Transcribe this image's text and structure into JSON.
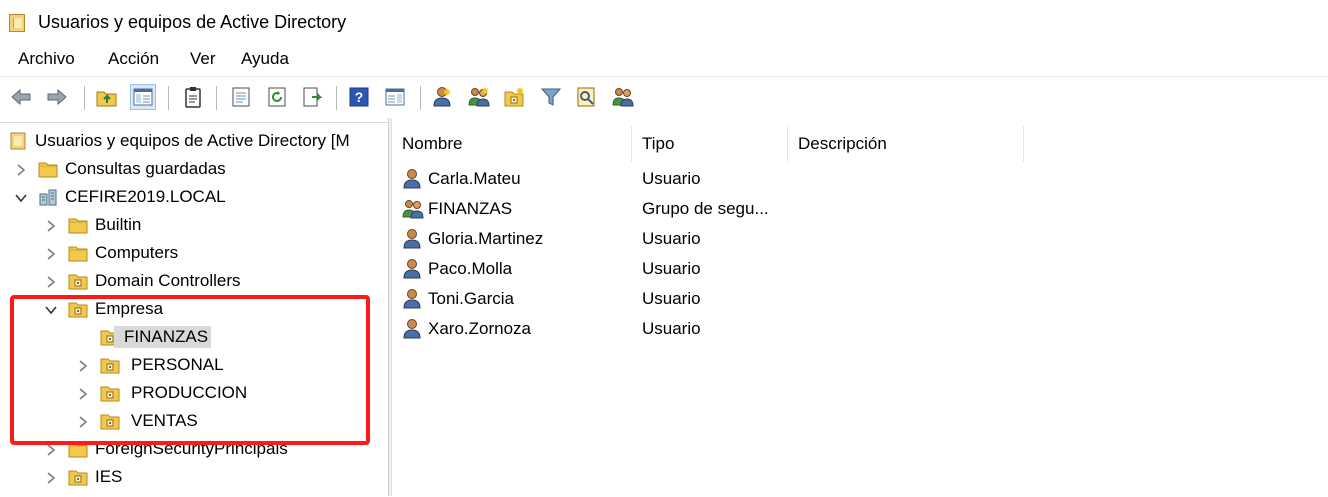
{
  "window": {
    "title": "Usuarios y equipos de Active Directory"
  },
  "menu": [
    "Archivo",
    "Acción",
    "Ver",
    "Ayuda"
  ],
  "toolbar": [
    "back-arrow-icon",
    "forward-arrow-icon",
    "up-folder-icon",
    "show-hide-tree-icon",
    "clipboard-icon",
    "properties-icon",
    "refresh-icon",
    "export-list-icon",
    "help-icon",
    "console-tree-icon",
    "new-user-icon",
    "new-group-icon",
    "new-ou-icon",
    "filter-icon",
    "find-icon",
    "add-to-group-icon"
  ],
  "tree": {
    "root": "Usuarios y equipos de Active Directory [M",
    "saved_queries": "Consultas guardadas",
    "domain": "CEFIRE2019.LOCAL",
    "children": [
      "Builtin",
      "Computers",
      "Domain Controllers"
    ],
    "empresa": "Empresa",
    "empresa_children": [
      "FINANZAS",
      "PERSONAL",
      "PRODUCCION",
      "VENTAS"
    ],
    "after": [
      "ForeignSecurityPrincipals",
      "IES"
    ]
  },
  "list": {
    "columns": {
      "name": "Nombre",
      "type": "Tipo",
      "description": "Descripción"
    },
    "rows": [
      {
        "name": "Carla.Mateu",
        "type": "Usuario",
        "icon": "user-icon"
      },
      {
        "name": "FINANZAS",
        "type": "Grupo de segu...",
        "icon": "group-icon"
      },
      {
        "name": "Gloria.Martinez",
        "type": "Usuario",
        "icon": "user-icon"
      },
      {
        "name": "Paco.Molla",
        "type": "Usuario",
        "icon": "user-icon"
      },
      {
        "name": "Toni.Garcia",
        "type": "Usuario",
        "icon": "user-icon"
      },
      {
        "name": "Xaro.Zornoza",
        "type": "Usuario",
        "icon": "user-icon"
      }
    ]
  },
  "colors": {
    "highlight": "#ff1a1a",
    "selection": "#d9d9d9",
    "folder": "#f2c94c"
  }
}
